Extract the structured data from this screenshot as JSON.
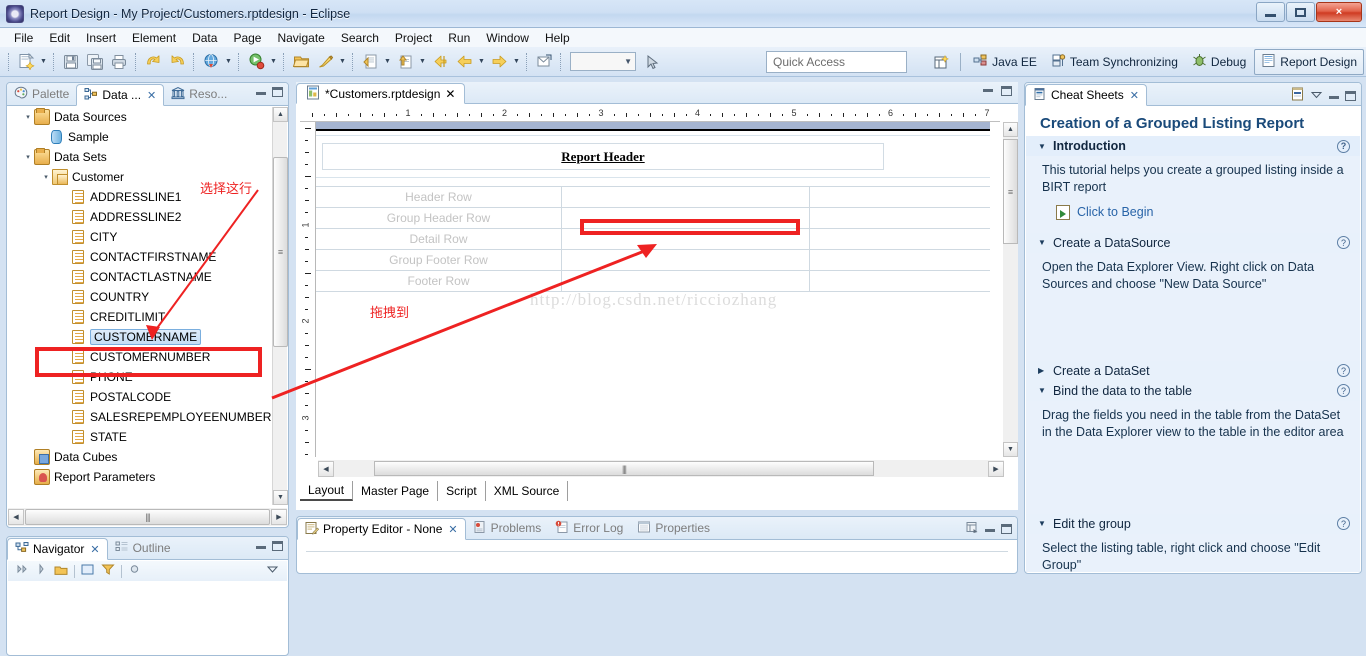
{
  "window": {
    "title": "Report Design - My Project/Customers.rptdesign - Eclipse",
    "app_icon": "eclipse-icon",
    "buttons": {
      "minimize": "minimize-button",
      "maximize": "maximize-button",
      "close": "×"
    }
  },
  "menubar": {
    "items": [
      "File",
      "Edit",
      "Insert",
      "Element",
      "Data",
      "Page",
      "Navigate",
      "Search",
      "Project",
      "Run",
      "Window",
      "Help"
    ]
  },
  "toolbar": {
    "combo_value": "",
    "quick_access": {
      "placeholder": "Quick Access",
      "value": "Quick Access"
    },
    "buttons": [
      {
        "name": "new-wizard-icon",
        "glyph": "📄"
      },
      {
        "name": "save-icon",
        "glyph": "💾"
      },
      {
        "name": "save-all-icon",
        "glyph": "🗄"
      },
      {
        "name": "print-icon",
        "glyph": "🖨"
      },
      {
        "name": "undo-icon",
        "glyph": "↩"
      },
      {
        "name": "redo-icon",
        "glyph": "↪"
      },
      {
        "name": "web-preview-icon",
        "glyph": "🌐"
      },
      {
        "name": "run-icon",
        "glyph": "▶"
      },
      {
        "name": "open-icon",
        "glyph": "📂"
      },
      {
        "name": "format-brush-icon",
        "glyph": "🖌"
      },
      {
        "name": "annotate-icon",
        "glyph": "📝"
      },
      {
        "name": "publish-icon",
        "glyph": "📤"
      },
      {
        "name": "back-history-icon",
        "glyph": "⇦"
      },
      {
        "name": "back-icon",
        "glyph": "⬅"
      },
      {
        "name": "forward-icon",
        "glyph": "➡"
      }
    ]
  },
  "perspectives": {
    "open_button": "open-perspective-icon",
    "items": [
      {
        "label": "Java EE",
        "icon": "java-ee-icon",
        "active": false
      },
      {
        "label": "Team Synchronizing",
        "icon": "team-sync-icon",
        "active": false
      },
      {
        "label": "Debug",
        "icon": "debug-icon",
        "active": false
      },
      {
        "label": "Report Design",
        "icon": "report-design-icon",
        "active": true
      }
    ]
  },
  "data_explorer": {
    "tabs": [
      {
        "label": "Palette",
        "icon": "palette-icon",
        "active": false,
        "closable": false
      },
      {
        "label": "Data ...",
        "icon": "data-explorer-icon",
        "active": true,
        "closable": true
      },
      {
        "label": "Reso...",
        "icon": "resource-explorer-icon",
        "active": false,
        "closable": false
      }
    ],
    "tree": [
      {
        "label": "Data Sources",
        "icon": "folder-icon",
        "indent": 0,
        "twisty": "▾",
        "selected": false
      },
      {
        "label": "Sample",
        "icon": "datasource-icon",
        "indent": 1,
        "twisty": "",
        "selected": false
      },
      {
        "label": "Data Sets",
        "icon": "folder-icon",
        "indent": 0,
        "twisty": "▾",
        "selected": false
      },
      {
        "label": "Customer",
        "icon": "dataset-icon",
        "indent": 1,
        "twisty": "▾",
        "selected": false
      },
      {
        "label": "ADDRESSLINE1",
        "icon": "column-icon",
        "indent": 2,
        "twisty": "",
        "selected": false
      },
      {
        "label": "ADDRESSLINE2",
        "icon": "column-icon",
        "indent": 2,
        "twisty": "",
        "selected": false
      },
      {
        "label": "CITY",
        "icon": "column-icon",
        "indent": 2,
        "twisty": "",
        "selected": false
      },
      {
        "label": "CONTACTFIRSTNAME",
        "icon": "column-icon",
        "indent": 2,
        "twisty": "",
        "selected": false
      },
      {
        "label": "CONTACTLASTNAME",
        "icon": "column-icon",
        "indent": 2,
        "twisty": "",
        "selected": false
      },
      {
        "label": "COUNTRY",
        "icon": "column-icon",
        "indent": 2,
        "twisty": "",
        "selected": false
      },
      {
        "label": "CREDITLIMIT",
        "icon": "column-icon",
        "indent": 2,
        "twisty": "",
        "selected": false
      },
      {
        "label": "CUSTOMERNAME",
        "icon": "column-icon",
        "indent": 2,
        "twisty": "",
        "selected": true
      },
      {
        "label": "CUSTOMERNUMBER",
        "icon": "column-icon",
        "indent": 2,
        "twisty": "",
        "selected": false
      },
      {
        "label": "PHONE",
        "icon": "column-icon",
        "indent": 2,
        "twisty": "",
        "selected": false
      },
      {
        "label": "POSTALCODE",
        "icon": "column-icon",
        "indent": 2,
        "twisty": "",
        "selected": false
      },
      {
        "label": "SALESREPEMPLOYEENUMBER",
        "icon": "column-icon",
        "indent": 2,
        "twisty": "",
        "selected": false
      },
      {
        "label": "STATE",
        "icon": "column-icon",
        "indent": 2,
        "twisty": "",
        "selected": false
      },
      {
        "label": "Data Cubes",
        "icon": "cube-icon",
        "indent": 0,
        "twisty": "",
        "selected": false
      },
      {
        "label": "Report Parameters",
        "icon": "parameter-icon",
        "indent": 0,
        "twisty": "",
        "selected": false
      }
    ]
  },
  "navigator": {
    "tabs": [
      {
        "label": "Navigator",
        "icon": "navigator-icon",
        "active": true,
        "closable": true
      },
      {
        "label": "Outline",
        "icon": "outline-icon",
        "active": false,
        "closable": false
      }
    ]
  },
  "editor": {
    "tab": {
      "label": "*Customers.rptdesign",
      "icon": "rptdesign-icon",
      "dirty": true
    },
    "ruler": {
      "h_marks": [
        "1",
        "2",
        "3",
        "4",
        "5",
        "6",
        "7"
      ],
      "v_marks": [
        "1",
        "2",
        "3"
      ]
    },
    "report_header": "Report Header",
    "table_rows": [
      "Header Row",
      "Group Header Row",
      "Detail Row",
      "Group Footer Row",
      "Footer Row"
    ],
    "watermark": "http://blog.csdn.net/ricciozhang",
    "bottom_tabs": [
      {
        "label": "Layout",
        "active": true
      },
      {
        "label": "Master Page",
        "active": false
      },
      {
        "label": "Script",
        "active": false
      },
      {
        "label": "XML Source",
        "active": false
      }
    ]
  },
  "annotations": {
    "select_this_row": "选择这行",
    "drag_to": "拖拽到",
    "accent_color": "#ee2222"
  },
  "property_panel": {
    "tabs": [
      {
        "label": "Property Editor - None",
        "icon": "property-editor-icon",
        "active": true,
        "closable": true
      },
      {
        "label": "Problems",
        "icon": "problems-icon",
        "active": false,
        "closable": false
      },
      {
        "label": "Error Log",
        "icon": "error-log-icon",
        "active": false,
        "closable": false
      },
      {
        "label": "Properties",
        "icon": "properties-icon",
        "active": false,
        "closable": false
      }
    ]
  },
  "cheat_sheets": {
    "tab": {
      "label": "Cheat Sheets",
      "icon": "cheat-sheets-icon",
      "closable": true
    },
    "title": "Creation of a Grouped Listing Report",
    "help_glyph": "?",
    "sections": [
      {
        "heading": "Introduction",
        "expanded": true,
        "current": true,
        "body": "This tutorial helps you create a grouped listing inside a BIRT report",
        "link": "Click to Begin"
      },
      {
        "heading": "Create a DataSource",
        "expanded": true,
        "current": false,
        "body": "Open the Data Explorer View. Right click on Data Sources and choose \"New Data Source\"",
        "link": ""
      },
      {
        "heading": "Create a DataSet",
        "expanded": false,
        "current": false,
        "body": "",
        "link": ""
      },
      {
        "heading": "Bind the data to the table",
        "expanded": true,
        "current": false,
        "body": "Drag the fields you need in the table from the DataSet in the Data Explorer view to the table in the editor area",
        "link": ""
      },
      {
        "heading": "Edit the group",
        "expanded": true,
        "current": false,
        "body": "Select the listing table, right click and choose \"Edit Group\"",
        "link": ""
      }
    ]
  }
}
